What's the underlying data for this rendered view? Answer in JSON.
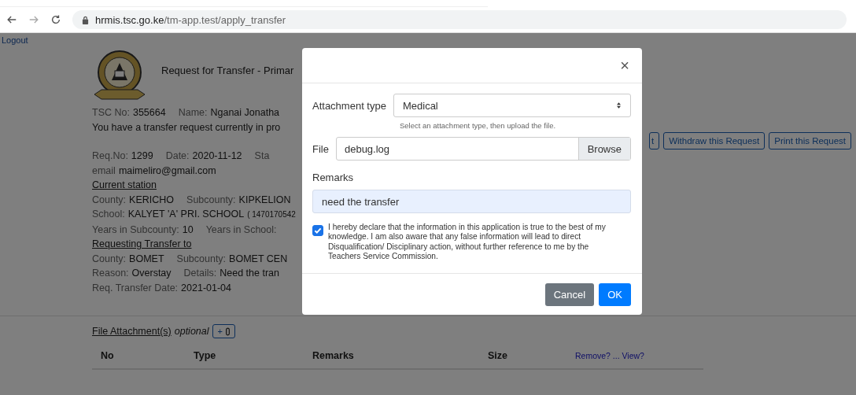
{
  "browser": {
    "url_host": "hrmis.tsc.go.ke",
    "url_path": "/tm-app.test/apply_transfer"
  },
  "page": {
    "logout": "Logout",
    "title": "Request for Transfer - Primar",
    "lines": [
      {
        "kind": "fields",
        "items": [
          {
            "label": "TSC No:",
            "value": "355664"
          },
          {
            "label": "Name:",
            "value": "Nganai Jonatha"
          }
        ]
      },
      {
        "kind": "note",
        "text": "You have a transfer request currently in pro"
      },
      {
        "kind": "gap"
      },
      {
        "kind": "fields",
        "items": [
          {
            "label": "Req.No:",
            "value": "1299"
          },
          {
            "label": "Date:",
            "value": "2020-11-12"
          },
          {
            "label": "Sta",
            "value": ""
          }
        ]
      },
      {
        "kind": "fields",
        "items": [
          {
            "label": "email",
            "value": "maimeliro@gmail.com"
          }
        ]
      },
      {
        "kind": "heading",
        "text": "Current station"
      },
      {
        "kind": "fields",
        "items": [
          {
            "label": "County:",
            "value": "KERICHO"
          },
          {
            "label": "Subcounty:",
            "value": "KIPKELION"
          }
        ]
      },
      {
        "kind": "fields",
        "items": [
          {
            "label": "School:",
            "value": "KALYET 'A' PRI. SCHOOL",
            "code": "( 1470170542"
          }
        ]
      },
      {
        "kind": "fields",
        "items": [
          {
            "label": "Years in Subcounty:",
            "value": "10"
          },
          {
            "label": "Years in School:",
            "value": ""
          }
        ]
      },
      {
        "kind": "heading",
        "text": "Requesting Transfer to"
      },
      {
        "kind": "fields",
        "items": [
          {
            "label": "County:",
            "value": "BOMET"
          },
          {
            "label": "Subcounty:",
            "value": "BOMET CEN"
          }
        ]
      },
      {
        "kind": "fields",
        "items": [
          {
            "label": "Reason:",
            "value": "Overstay"
          },
          {
            "label": "Details:",
            "value": "Need the tran"
          }
        ]
      },
      {
        "kind": "fields",
        "items": [
          {
            "label": "Req. Transfer Date:",
            "value": "2021-01-04"
          }
        ]
      }
    ],
    "actions": [
      "t",
      "Withdraw this Request",
      "Print this Request"
    ],
    "attachments": {
      "heading": "File Attachment(s)",
      "note": "optional",
      "add_label": "+",
      "columns": [
        "No",
        "Type",
        "Remarks",
        "Size"
      ],
      "links": "Remove? ... View?"
    }
  },
  "modal": {
    "close": "×",
    "type_label": "Attachment type",
    "type_value": "Medical",
    "type_help": "Select an attachment type, then upload the file.",
    "file_label": "File",
    "file_value": "debug.log",
    "browse": "Browse",
    "remarks_label": "Remarks",
    "remarks_value": "need the transfer",
    "declaration": {
      "checked": true,
      "text": "I hereby declare that the information in this application is true to the best of my knowledge. I am also aware that any false information will lead to direct Disqualification/ Disciplinary action, without further reference to me by the Teachers Service Commission."
    },
    "buttons": [
      {
        "label": "Cancel",
        "kind": "secondary"
      },
      {
        "label": "OK",
        "kind": "primary"
      }
    ]
  }
}
